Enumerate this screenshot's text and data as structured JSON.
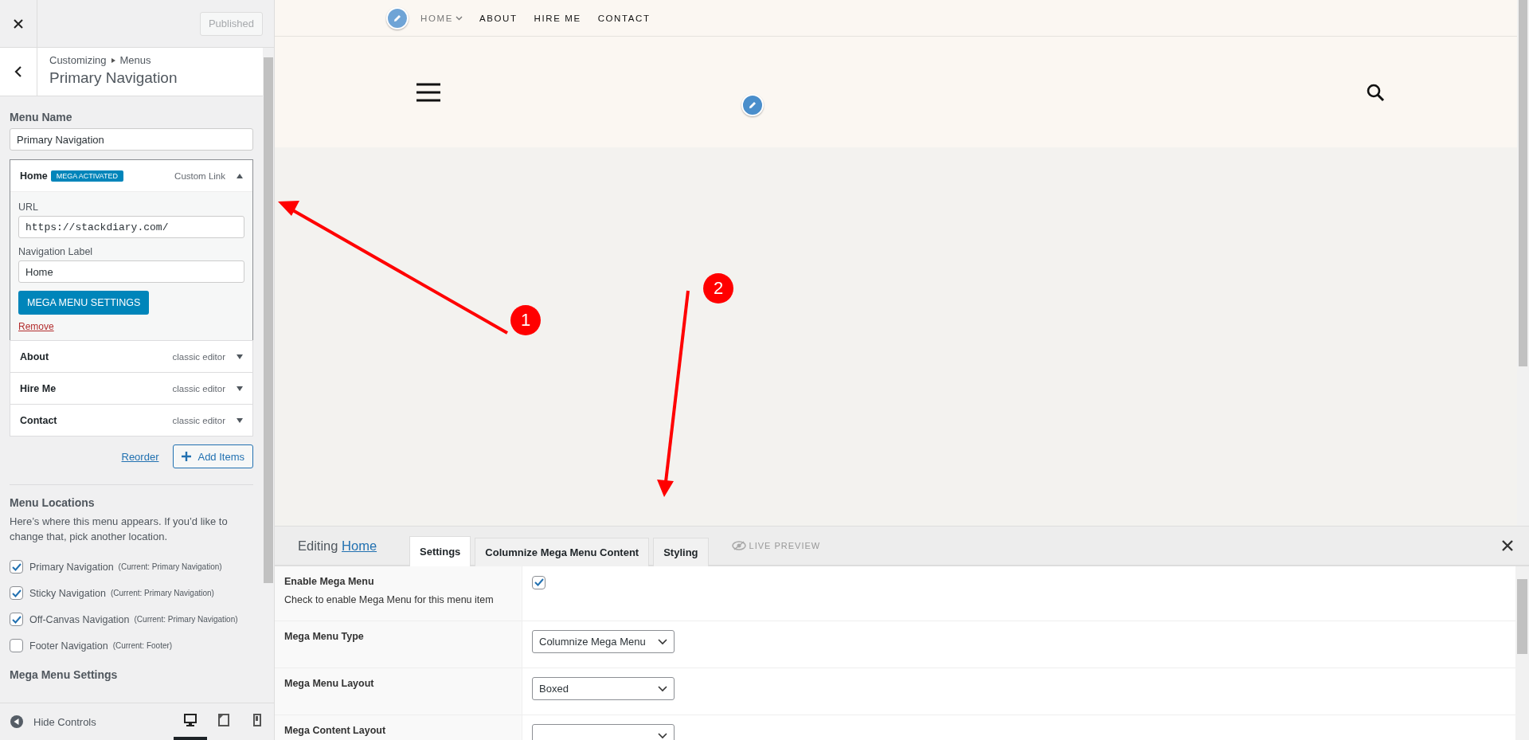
{
  "customizer": {
    "published_button": "Published",
    "breadcrumb": [
      "Customizing",
      "Menus"
    ],
    "title": "Primary Navigation"
  },
  "menu_name": {
    "label": "Menu Name",
    "value": "Primary Navigation"
  },
  "menu_items": [
    {
      "title": "Home",
      "badge": "MEGA ACTIVATED",
      "type": "Custom Link",
      "expanded": true,
      "editor": {
        "url_label": "URL",
        "url": "https://stackdiary.com/",
        "nav_label_label": "Navigation Label",
        "nav_label": "Home",
        "settings_button": "MEGA MENU SETTINGS",
        "remove_link": "Remove"
      }
    },
    {
      "title": "About",
      "type": "classic editor",
      "expanded": false
    },
    {
      "title": "Hire Me",
      "type": "classic editor",
      "expanded": false
    },
    {
      "title": "Contact",
      "type": "classic editor",
      "expanded": false
    }
  ],
  "reorder_link": "Reorder",
  "add_items_button": "Add Items",
  "menu_locations": {
    "title": "Menu Locations",
    "description": "Here’s where this menu appears. If you’d like to change that, pick another location.",
    "locations": [
      {
        "name": "Primary Navigation",
        "current": "(Current: Primary Navigation)",
        "checked": true
      },
      {
        "name": "Sticky Navigation",
        "current": "(Current: Primary Navigation)",
        "checked": true
      },
      {
        "name": "Off-Canvas Navigation",
        "current": "(Current: Primary Navigation)",
        "checked": true
      },
      {
        "name": "Footer Navigation",
        "current": "(Current: Footer)",
        "checked": false
      }
    ]
  },
  "next_section": "Mega Menu Settings",
  "footer": {
    "hide_controls": "Hide Controls",
    "devices": [
      {
        "kind": "desktop",
        "selected": true
      },
      {
        "kind": "tablet",
        "selected": false
      },
      {
        "kind": "mobile",
        "selected": false
      }
    ]
  },
  "preview": {
    "nav": [
      {
        "label": "HOME",
        "has_submenu": true,
        "selected": true
      },
      {
        "label": "ABOUT",
        "has_submenu": false,
        "selected": false
      },
      {
        "label": "HIRE ME",
        "has_submenu": false,
        "selected": false
      },
      {
        "label": "CONTACT",
        "has_submenu": false,
        "selected": false
      }
    ]
  },
  "mega_panel": {
    "editing_prefix": "Editing",
    "editing_link": "Home",
    "tabs": [
      {
        "label": "Settings",
        "selected": true
      },
      {
        "label": "Columnize Mega Menu Content",
        "selected": false
      },
      {
        "label": "Styling",
        "selected": false
      }
    ],
    "live_preview": "LIVE PREVIEW",
    "rows": [
      {
        "kind": "checkbox",
        "label": "Enable Mega Menu",
        "description": "Check to enable Mega Menu for this menu item",
        "checked": true
      },
      {
        "kind": "select",
        "label": "Mega Menu Type",
        "value": "Columnize Mega Menu"
      },
      {
        "kind": "select",
        "label": "Mega Menu Layout",
        "value": "Boxed"
      },
      {
        "kind": "select",
        "label": "Mega Content Layout"
      }
    ]
  },
  "annotations": [
    {
      "number": "1"
    },
    {
      "number": "2"
    }
  ]
}
